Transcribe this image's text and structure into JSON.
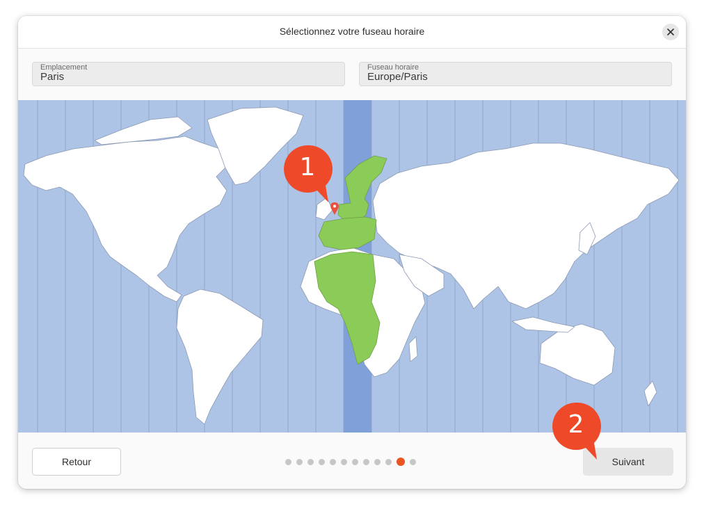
{
  "window": {
    "title": "Sélectionnez votre fuseau horaire"
  },
  "fields": {
    "location": {
      "label": "Emplacement",
      "value": "Paris"
    },
    "timezone": {
      "label": "Fuseau horaire",
      "value": "Europe/Paris"
    }
  },
  "map": {
    "selected_zone": "Europe/Paris",
    "highlight_color": "#7fa0d9",
    "region_color": "#8bcb58",
    "ocean_color": "#aec4e6",
    "pin_color": "#e8523f"
  },
  "footer": {
    "back_label": "Retour",
    "next_label": "Suivant"
  },
  "pagination": {
    "total": 12,
    "current": 11
  },
  "callouts": [
    {
      "label": "1"
    },
    {
      "label": "2"
    }
  ],
  "accent_color": "#e95420"
}
